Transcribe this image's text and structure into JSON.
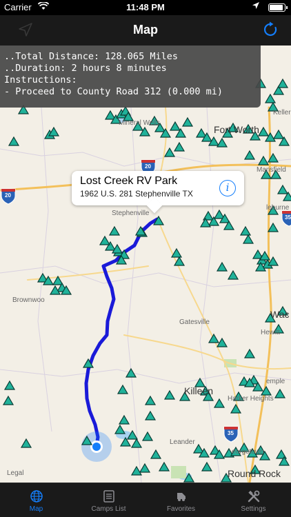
{
  "status_bar": {
    "carrier": "Carrier",
    "time": "11:48 PM",
    "battery_level": 0.9
  },
  "nav": {
    "title": "Map",
    "left_icon": "location-arrow-icon",
    "right_icon": "refresh-icon"
  },
  "route_info": {
    "line1": "..Total Distance: 128.065 Miles",
    "line2": "..Duration: 2 hours 8 minutes",
    "line3": "",
    "line4": "Instructions:",
    "line5": "- Proceed to County Road 312 (0.000 mi)"
  },
  "callout": {
    "title": "Lost Creek RV Park",
    "address": "1962 U.S. 281 Stephenville  TX",
    "info_glyph": "i"
  },
  "map_labels": {
    "fort_worth": "Fort Worth",
    "mineral_wells": "Mineral Wells",
    "stephenville": "Stephenville",
    "brownwood": "Brownwoo",
    "gatesville": "Gatesville",
    "killeen": "Killeen",
    "harker_heights": "Harker Heights",
    "mansfield": "Mansfield",
    "keller": "Keller",
    "hewitt": "Hewitt",
    "waco": "Wac",
    "leander": "Leander",
    "round_rock": "Round Rock",
    "georgetown": "eorgetown",
    "temple": "emple",
    "cleburne": "leburne",
    "i20_west": "20",
    "i20_east": "20",
    "i35_north": "35",
    "i35_south": "35",
    "legal": "Legal"
  },
  "tabs": [
    {
      "label": "Map",
      "icon": "globe-icon",
      "active": true
    },
    {
      "label": "Camps List",
      "icon": "list-icon",
      "active": false
    },
    {
      "label": "Favorites",
      "icon": "rv-icon",
      "active": false
    },
    {
      "label": "Settings",
      "icon": "tools-icon",
      "active": false
    }
  ],
  "colors": {
    "accent": "#147efb",
    "route": "#1a1ad8",
    "camp_marker": "#20b29a",
    "map_background": "#f3efe6"
  }
}
